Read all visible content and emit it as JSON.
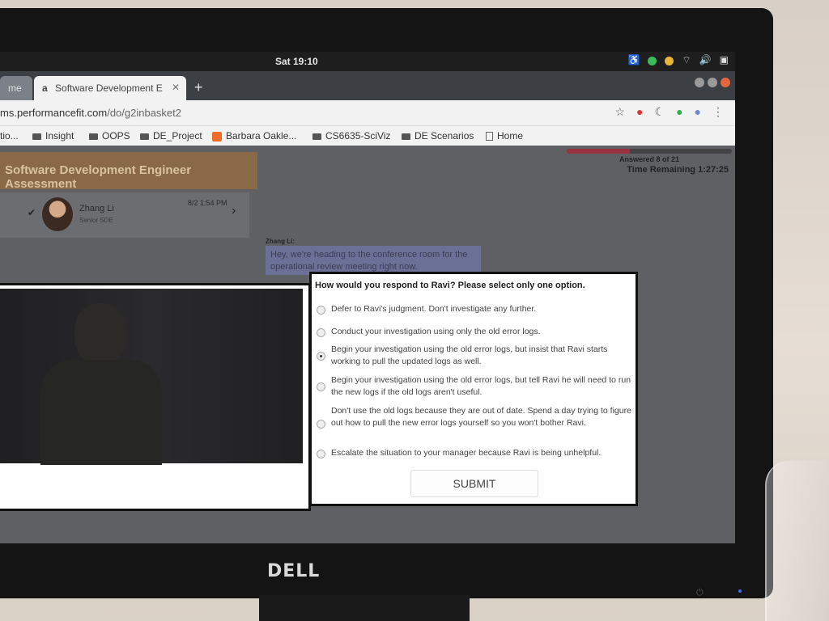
{
  "os": {
    "clock": "Sat 19:10"
  },
  "browser": {
    "tabs": [
      {
        "label": "me",
        "active": false
      },
      {
        "label": "Software Development E",
        "active": true
      }
    ],
    "url": {
      "domain": "ms.performancefit.com",
      "path": "/do/g2inbasket2"
    },
    "bookmarks": [
      {
        "label": "tio...",
        "icon": "folder-icon"
      },
      {
        "label": "Insight",
        "icon": "folder-icon"
      },
      {
        "label": "OOPS",
        "icon": "folder-icon"
      },
      {
        "label": "DE_Project",
        "icon": "folder-icon"
      },
      {
        "label": "Barbara Oakle...",
        "icon": "blogger-icon"
      },
      {
        "label": "CS6635-SciViz",
        "icon": "folder-icon"
      },
      {
        "label": "DE Scenarios",
        "icon": "folder-icon"
      },
      {
        "label": "Home",
        "icon": "page-icon"
      }
    ]
  },
  "assessment": {
    "title": "Software Development Engineer Assessment",
    "progress_label": "Answered 8 of 21",
    "progress_fraction": 0.381,
    "time_remaining": "Time Remaining 1:27:25"
  },
  "inbox": {
    "sender": "Zhang Li",
    "role": "Senior SDE",
    "date": "8/2 1:54 PM"
  },
  "chat": {
    "name": "Zhang Li:",
    "message": "Hey, we're heading to the conference room for the operational review meeting right now."
  },
  "question": {
    "prompt": "How would you respond to Ravi? Please select only one option.",
    "selected_index": 2,
    "options": [
      "Defer to Ravi's judgment. Don't investigate any further.",
      "Conduct your investigation using only the old error logs.",
      "Begin your investigation using the old error logs, but insist that Ravi starts working to pull the updated logs as well.",
      "Begin your investigation using the old error logs, but tell Ravi he will need to run the new logs if the old logs aren't useful.",
      "Don't use the old logs because they are out of date. Spend a day trying to figure out how to pull the new error logs yourself so you won't bother Ravi.",
      "Escalate the situation to your manager because Ravi is being unhelpful."
    ],
    "submit_label": "SUBMIT"
  },
  "monitor": {
    "brand": "DELL"
  }
}
